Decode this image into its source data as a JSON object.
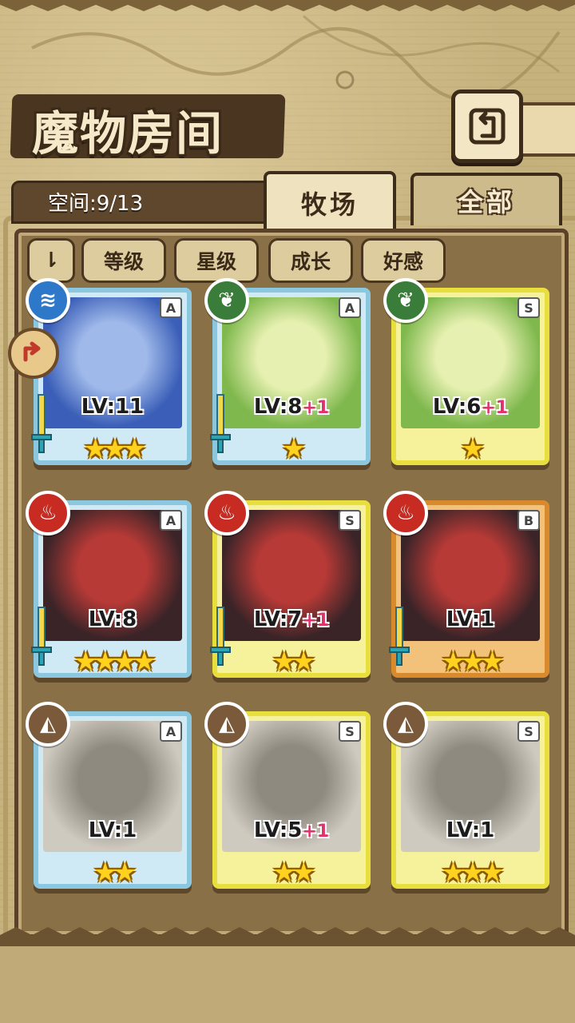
{
  "header": {
    "title": "魔物房间"
  },
  "capacity": {
    "text": "空间:9/13"
  },
  "tabs": [
    {
      "label": "牧场",
      "active": true
    },
    {
      "label": "全部",
      "active": false
    }
  ],
  "filters": {
    "toggle_label": "⇂",
    "items": [
      "等级",
      "星级",
      "成长",
      "好感"
    ]
  },
  "monsters": [
    {
      "element": "water",
      "rank": "A",
      "level": "LV:11",
      "plus": "",
      "stars": "★★★",
      "frame": "blue",
      "equipped": true
    },
    {
      "element": "grass",
      "rank": "A",
      "level": "LV:8",
      "plus": "+1",
      "stars": "★",
      "frame": "blue",
      "equipped": true
    },
    {
      "element": "grass",
      "rank": "S",
      "level": "LV:6",
      "plus": "+1",
      "stars": "★",
      "frame": "yellow",
      "equipped": false
    },
    {
      "element": "fire",
      "rank": "A",
      "level": "LV:8",
      "plus": "",
      "stars": "★★★★",
      "frame": "blue",
      "equipped": true
    },
    {
      "element": "fire",
      "rank": "S",
      "level": "LV:7",
      "plus": "+1",
      "stars": "★★",
      "frame": "yellow",
      "equipped": true
    },
    {
      "element": "fire",
      "rank": "B",
      "level": "LV:1",
      "plus": "",
      "stars": "★★★",
      "frame": "orange",
      "equipped": true
    },
    {
      "element": "earth",
      "rank": "A",
      "level": "LV:1",
      "plus": "",
      "stars": "★★",
      "frame": "blue",
      "equipped": false
    },
    {
      "element": "earth",
      "rank": "S",
      "level": "LV:5",
      "plus": "+1",
      "stars": "★★",
      "frame": "yellow",
      "equipped": false
    },
    {
      "element": "earth",
      "rank": "S",
      "level": "LV:1",
      "plus": "",
      "stars": "★★★",
      "frame": "yellow",
      "equipped": false
    }
  ],
  "colors": {
    "panel": "#8a7046",
    "frame_blue": "#8cc7e0",
    "frame_yellow": "#e8de3e",
    "frame_orange": "#d98a2c",
    "star": "#ffd21f",
    "plus": "#e0336b"
  },
  "icons": {
    "back": "return-arrow-icon",
    "side_badge": "share-arrow-icon"
  }
}
